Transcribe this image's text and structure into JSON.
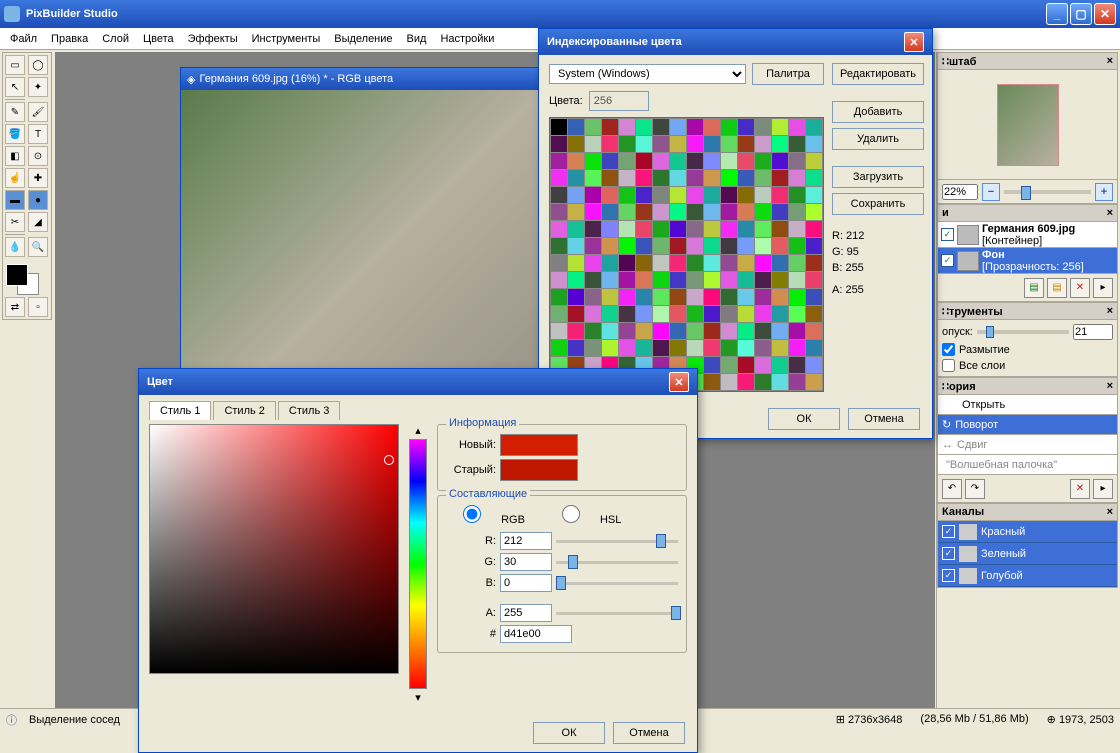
{
  "app_title": "PixBuilder Studio",
  "menu": [
    "Файл",
    "Правка",
    "Слой",
    "Цвета",
    "Эффекты",
    "Инструменты",
    "Выделение",
    "Вид",
    "Настройки"
  ],
  "doc_title": "Германия 609.jpg (16%) * - RGB цвета",
  "statusbar_left": "Выделение сосед",
  "statusbar_dim": "2736x3648",
  "statusbar_mem": "(28,56 Mb / 51,86 Mb)",
  "statusbar_pos": "1973, 2503",
  "right": {
    "scale_title": "∷штаб",
    "zoom_value": "22%",
    "layer1_name": "Германия 609.jpg",
    "layer1_sub": "[Контейнер]",
    "layer2_name": "Фон",
    "layer2_sub": "[Прозрачность: 256]",
    "tools_title": "∷трументы",
    "tol_label": "опуск:",
    "tol_value": "21",
    "blur_label": "Размытие",
    "all_layers_label": "Все слои",
    "history_title": "∷ория",
    "hist": [
      "Открыть",
      "Поворот",
      "Сдвиг",
      "\"Волшебная палочка\""
    ],
    "channels_title": "Каналы",
    "chan": [
      "Красный",
      "Зеленый",
      "Голубой"
    ]
  },
  "color_dialog": {
    "title": "Цвет",
    "tabs": [
      "Стиль 1",
      "Стиль 2",
      "Стиль 3"
    ],
    "info_title": "Информация",
    "new_label": "Новый:",
    "old_label": "Старый:",
    "new_color": "#d41e00",
    "old_color": "#c01800",
    "components_title": "Составляющие",
    "mode_rgb": "RGB",
    "mode_hsl": "HSL",
    "r": "212",
    "g": "30",
    "b": "0",
    "a": "255",
    "hex": "d41e00",
    "ok": "ОК",
    "cancel": "Отмена"
  },
  "indexed_dialog": {
    "title": "Индексированные цвета",
    "system_label": "System (Windows)",
    "palette_btn": "Палитра",
    "colors_label": "Цвета:",
    "colors_value": "256",
    "edit": "Редактировать",
    "add": "Добавить",
    "del": "Удалить",
    "load": "Загрузить",
    "save": "Сохранить",
    "r": "R: 212",
    "g": "G: 95",
    "b": "B: 255",
    "a": "A: 255",
    "ok": "ОК",
    "cancel": "Отмена"
  }
}
